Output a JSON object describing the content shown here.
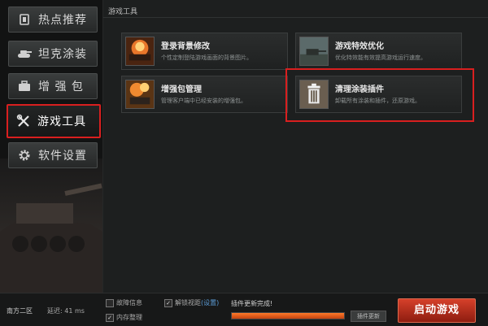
{
  "sidebar": {
    "items": [
      {
        "label": "热点推荐",
        "icon": "monitor-icon"
      },
      {
        "label": "坦克涂装",
        "icon": "tank-icon"
      },
      {
        "label": "增 强 包",
        "icon": "briefcase-icon"
      },
      {
        "label": "游戏工具",
        "icon": "tools-icon",
        "active": true
      },
      {
        "label": "软件设置",
        "icon": "gear-icon"
      }
    ]
  },
  "main": {
    "title": "游戏工具",
    "tools": [
      {
        "title": "登录背景修改",
        "desc": "个性定制登陆游戏画面的背景图片。"
      },
      {
        "title": "游戏特效优化",
        "desc": "优化特效能有效提高游戏运行速度。"
      },
      {
        "title": "增强包管理",
        "desc": "管理客户端中已经安装的增强包。"
      },
      {
        "title": "清理涂装插件",
        "desc": "卸载所有涂装和插件，还原游戏。"
      }
    ]
  },
  "bottom": {
    "server": "南方二区",
    "latency": "延迟: 41 ms",
    "options": {
      "fault_info": "故障信息",
      "memory_cleanup": "内存整理",
      "unlock_view": "解锁视距",
      "settings_link": "(设置)"
    },
    "status": "插件更新完成!",
    "progress": 1.0,
    "update_button": "插件更新",
    "launch_button": "启动游戏"
  },
  "colors": {
    "highlight": "#d91f1f",
    "progress": "#ff7a2a",
    "launch": "#c8371f"
  }
}
